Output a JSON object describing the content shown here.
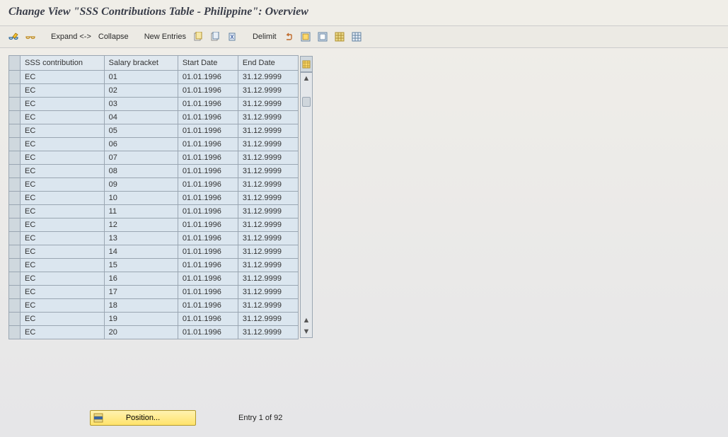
{
  "page_title": "Change View \"SSS Contributions Table - Philippine\": Overview",
  "toolbar": {
    "expand_label": "Expand <->",
    "collapse_label": "Collapse",
    "new_entries_label": "New Entries",
    "delimit_label": "Delimit"
  },
  "table": {
    "columns": {
      "contribution": "SSS contribution",
      "salary_bracket": "Salary bracket",
      "start_date": "Start Date",
      "end_date": "End Date"
    },
    "rows": [
      {
        "contribution": "EC",
        "salary_bracket": "01",
        "start_date": "01.01.1996",
        "end_date": "31.12.9999"
      },
      {
        "contribution": "EC",
        "salary_bracket": "02",
        "start_date": "01.01.1996",
        "end_date": "31.12.9999"
      },
      {
        "contribution": "EC",
        "salary_bracket": "03",
        "start_date": "01.01.1996",
        "end_date": "31.12.9999"
      },
      {
        "contribution": "EC",
        "salary_bracket": "04",
        "start_date": "01.01.1996",
        "end_date": "31.12.9999"
      },
      {
        "contribution": "EC",
        "salary_bracket": "05",
        "start_date": "01.01.1996",
        "end_date": "31.12.9999"
      },
      {
        "contribution": "EC",
        "salary_bracket": "06",
        "start_date": "01.01.1996",
        "end_date": "31.12.9999"
      },
      {
        "contribution": "EC",
        "salary_bracket": "07",
        "start_date": "01.01.1996",
        "end_date": "31.12.9999"
      },
      {
        "contribution": "EC",
        "salary_bracket": "08",
        "start_date": "01.01.1996",
        "end_date": "31.12.9999"
      },
      {
        "contribution": "EC",
        "salary_bracket": "09",
        "start_date": "01.01.1996",
        "end_date": "31.12.9999"
      },
      {
        "contribution": "EC",
        "salary_bracket": "10",
        "start_date": "01.01.1996",
        "end_date": "31.12.9999"
      },
      {
        "contribution": "EC",
        "salary_bracket": "11",
        "start_date": "01.01.1996",
        "end_date": "31.12.9999"
      },
      {
        "contribution": "EC",
        "salary_bracket": "12",
        "start_date": "01.01.1996",
        "end_date": "31.12.9999"
      },
      {
        "contribution": "EC",
        "salary_bracket": "13",
        "start_date": "01.01.1996",
        "end_date": "31.12.9999"
      },
      {
        "contribution": "EC",
        "salary_bracket": "14",
        "start_date": "01.01.1996",
        "end_date": "31.12.9999"
      },
      {
        "contribution": "EC",
        "salary_bracket": "15",
        "start_date": "01.01.1996",
        "end_date": "31.12.9999"
      },
      {
        "contribution": "EC",
        "salary_bracket": "16",
        "start_date": "01.01.1996",
        "end_date": "31.12.9999"
      },
      {
        "contribution": "EC",
        "salary_bracket": "17",
        "start_date": "01.01.1996",
        "end_date": "31.12.9999"
      },
      {
        "contribution": "EC",
        "salary_bracket": "18",
        "start_date": "01.01.1996",
        "end_date": "31.12.9999"
      },
      {
        "contribution": "EC",
        "salary_bracket": "19",
        "start_date": "01.01.1996",
        "end_date": "31.12.9999"
      },
      {
        "contribution": "EC",
        "salary_bracket": "20",
        "start_date": "01.01.1996",
        "end_date": "31.12.9999"
      }
    ]
  },
  "footer": {
    "position_label": "Position...",
    "entry_text": "Entry 1 of 92"
  }
}
